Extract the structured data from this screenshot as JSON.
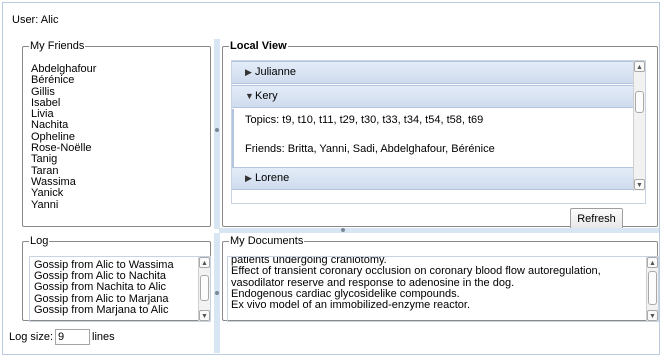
{
  "user": {
    "label": "User: Alic"
  },
  "friends": {
    "legend": "My Friends",
    "items": [
      "Abdelghafour",
      "Bérénice",
      "Gillis",
      "Isabel",
      "Livia",
      "Nachita",
      "Opheline",
      "Rose-Noëlle",
      "Tanig",
      "Taran",
      "Wassima",
      "Yanick",
      "Yanni"
    ]
  },
  "local_view": {
    "legend": "Local View",
    "sections": [
      {
        "title": "Julianne",
        "expanded": false
      },
      {
        "title": "Kery",
        "expanded": true,
        "topics": "Topics:  t9, t10, t11, t29, t30, t33, t34, t54, t58, t69",
        "friends": "Friends: Britta, Yanni, Sadi, Abdelghafour, Bérénice"
      },
      {
        "title": "Lorene",
        "expanded": false
      }
    ],
    "refresh_label": "Refresh"
  },
  "log": {
    "legend": "Log",
    "lines": [
      "Gossip from Alic to Wassima",
      "Gossip from Alic to Nachita",
      "Gossip from Nachita to Alic",
      "Gossip from Alic to Marjana",
      "Gossip from Marjana to Alic"
    ],
    "size_label": "Log size:",
    "size_value": "9",
    "size_unit": "lines"
  },
  "documents": {
    "legend": "My Documents",
    "lines": [
      "patients undergoing craniotomy.",
      "Effect of transient coronary occlusion on coronary blood flow autoregulation, vasodilator reserve and response to adenosine in the dog.",
      "Endogenous cardiac glycosidelike compounds.",
      "Ex vivo model of an immobilized-enzyme reactor."
    ]
  },
  "colors": {
    "accent": "#d8e5f3",
    "header": "#cfdcee"
  },
  "icons": {
    "collapsed": "triangle-right-icon",
    "expanded": "triangle-down-icon"
  }
}
